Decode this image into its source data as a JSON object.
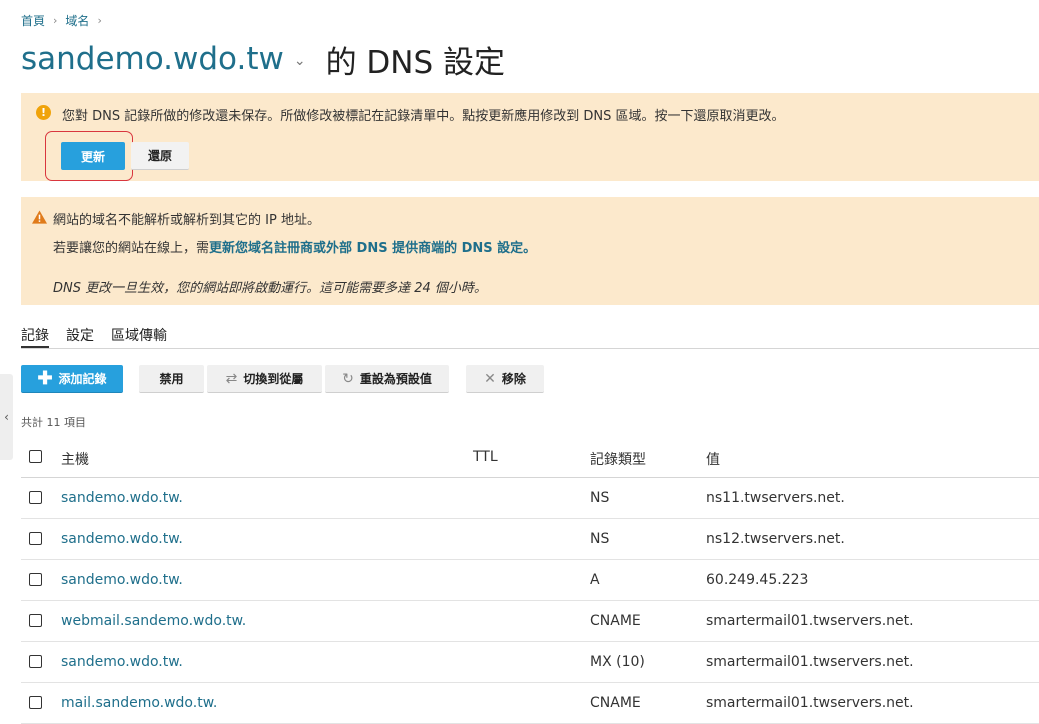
{
  "breadcrumb": {
    "home": "首頁",
    "domains": "域名"
  },
  "title": {
    "domain": "sandemo.wdo.tw",
    "suffix": "的 DNS 設定"
  },
  "alert_unsaved": {
    "message": "您對 DNS 記錄所做的修改還未保存。所做修改被標記在記錄清單中。點按更新應用修改到 DNS 區域。按一下還原取消更改。",
    "update_label": "更新",
    "revert_label": "還原"
  },
  "alert_warning": {
    "line1": "網站的域名不能解析或解析到其它的 IP 地址。",
    "line2_prefix": "若要讓您的網站在線上，需",
    "line2_link": "更新您域名註冊商或外部 DNS 提供商端的 DNS 設定。",
    "line3": "DNS 更改一旦生效，您的網站即將啟動運行。這可能需要多達 24 個小時。"
  },
  "tabs": [
    "記錄",
    "設定",
    "區域傳輸"
  ],
  "toolbar": {
    "add": "添加記錄",
    "disable": "禁用",
    "switch": "切換到從屬",
    "reset": "重設為預設值",
    "remove": "移除"
  },
  "count": "共計 11 項目",
  "table": {
    "headers": {
      "host": "主機",
      "ttl": "TTL",
      "type": "記錄類型",
      "value": "值"
    },
    "rows": [
      {
        "host": "sandemo.wdo.tw.",
        "ttl": "",
        "type": "NS",
        "value": "ns11.twservers.net."
      },
      {
        "host": "sandemo.wdo.tw.",
        "ttl": "",
        "type": "NS",
        "value": "ns12.twservers.net."
      },
      {
        "host": "sandemo.wdo.tw.",
        "ttl": "",
        "type": "A",
        "value": "60.249.45.223"
      },
      {
        "host": "webmail.sandemo.wdo.tw.",
        "ttl": "",
        "type": "CNAME",
        "value": "smartermail01.twservers.net."
      },
      {
        "host": "sandemo.wdo.tw.",
        "ttl": "",
        "type": "MX (10)",
        "value": "smartermail01.twservers.net."
      },
      {
        "host": "mail.sandemo.wdo.tw.",
        "ttl": "",
        "type": "CNAME",
        "value": "smartermail01.twservers.net."
      }
    ]
  },
  "colors": {
    "link": "#1f6f8b",
    "accent": "#27a0dd",
    "alert_bg": "#fce9cc",
    "highlight": "#d9363e"
  }
}
